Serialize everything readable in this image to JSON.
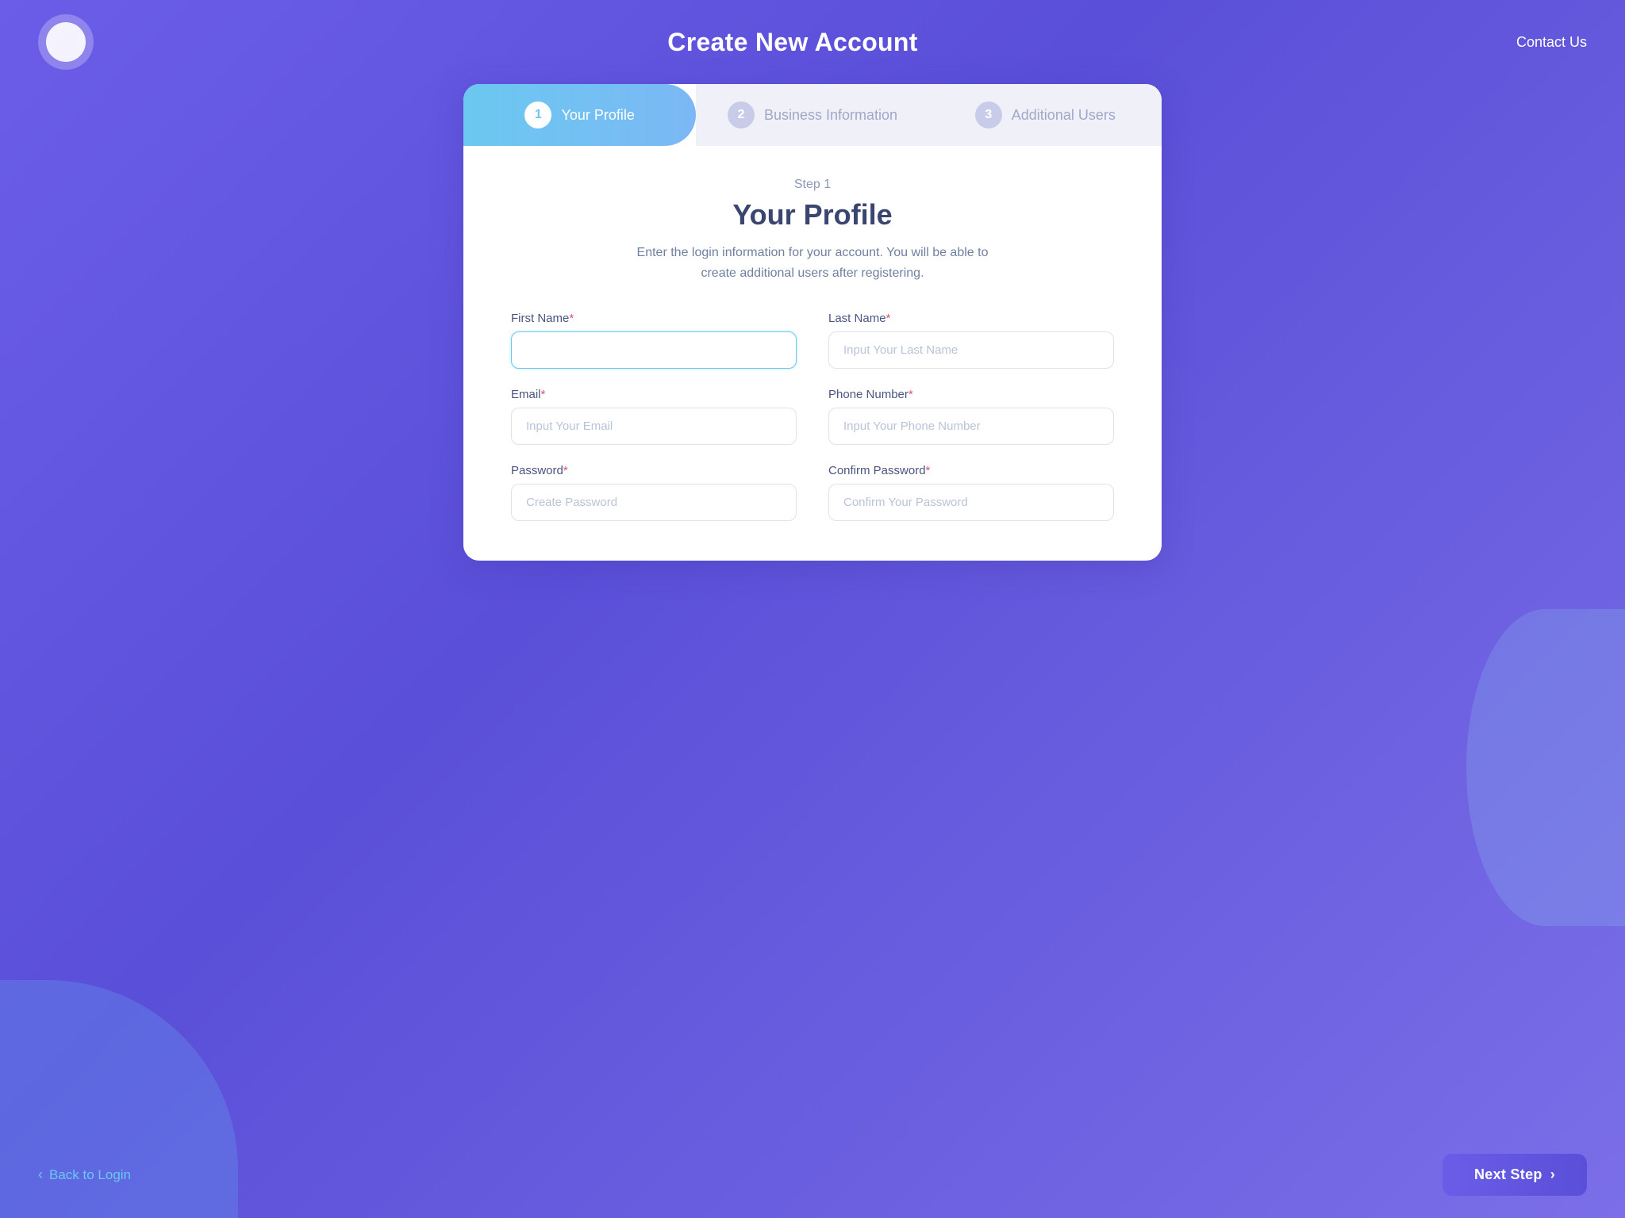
{
  "header": {
    "title": "Create New Account",
    "contact_us_label": "Contact Us"
  },
  "steps": [
    {
      "number": "1",
      "label": "Your Profile",
      "state": "active"
    },
    {
      "number": "2",
      "label": "Business Information",
      "state": "inactive"
    },
    {
      "number": "3",
      "label": "Additional Users",
      "state": "inactive"
    }
  ],
  "form": {
    "step_label": "Step 1",
    "title": "Your Profile",
    "description": "Enter the login information for your account. You will be able to create additional users after registering.",
    "fields": {
      "first_name": {
        "label": "First Name",
        "required": true,
        "placeholder": "",
        "value": ""
      },
      "last_name": {
        "label": "Last Name",
        "required": true,
        "placeholder": "Input Your Last Name",
        "value": ""
      },
      "email": {
        "label": "Email",
        "required": true,
        "placeholder": "Input Your Email",
        "value": ""
      },
      "phone": {
        "label": "Phone Number",
        "required": true,
        "placeholder": "Input Your Phone Number",
        "value": ""
      },
      "password": {
        "label": "Password",
        "required": true,
        "placeholder": "Create Password",
        "value": ""
      },
      "confirm_password": {
        "label": "Confirm Password",
        "required": true,
        "placeholder": "Confirm Your Password",
        "value": ""
      }
    }
  },
  "footer": {
    "back_label": "Back to Login",
    "next_label": "Next Step"
  }
}
